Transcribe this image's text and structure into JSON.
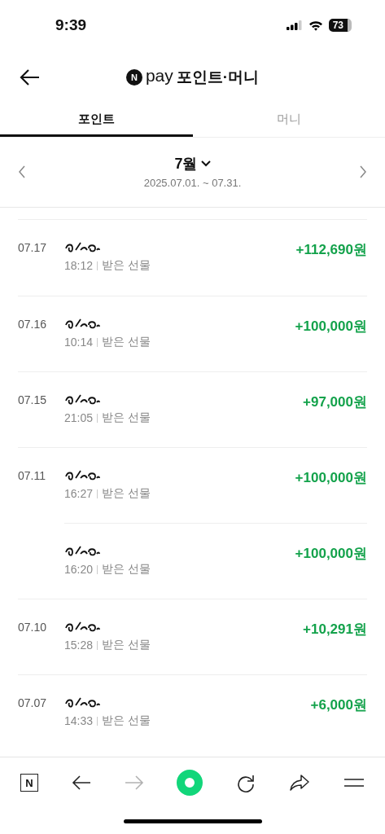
{
  "status_bar": {
    "time": "9:39",
    "battery": "73"
  },
  "header": {
    "logo_letter": "N",
    "logo_word": "pay",
    "title": "포인트·머니"
  },
  "tabs": [
    {
      "label": "포인트",
      "selected": true
    },
    {
      "label": "머니",
      "selected": false
    }
  ],
  "period": {
    "month": "7월",
    "range": "2025.07.01. ~ 07.31."
  },
  "transactions": [
    {
      "date": "07.17",
      "time": "18:12",
      "type": "받은 선물",
      "amount": "+112,690원"
    },
    {
      "date": "07.16",
      "time": "10:14",
      "type": "받은 선물",
      "amount": "+100,000원"
    },
    {
      "date": "07.15",
      "time": "21:05",
      "type": "받은 선물",
      "amount": "+97,000원"
    },
    {
      "date": "07.11",
      "time": "16:27",
      "type": "받은 선물",
      "amount": "+100,000원"
    },
    {
      "time": "16:20",
      "type": "받은 선물",
      "amount": "+100,000원"
    },
    {
      "date": "07.10",
      "time": "15:28",
      "type": "받은 선물",
      "amount": "+10,291원"
    },
    {
      "date": "07.07",
      "time": "14:33",
      "type": "받은 선물",
      "amount": "+6,000원"
    }
  ],
  "toolbar": [
    {
      "kind": "home",
      "label": "N",
      "disabled": false
    },
    {
      "kind": "back",
      "disabled": false
    },
    {
      "kind": "forward",
      "disabled": true
    },
    {
      "kind": "green",
      "disabled": false
    },
    {
      "kind": "reload",
      "disabled": false
    },
    {
      "kind": "share",
      "disabled": false
    },
    {
      "kind": "menu",
      "disabled": false
    }
  ]
}
